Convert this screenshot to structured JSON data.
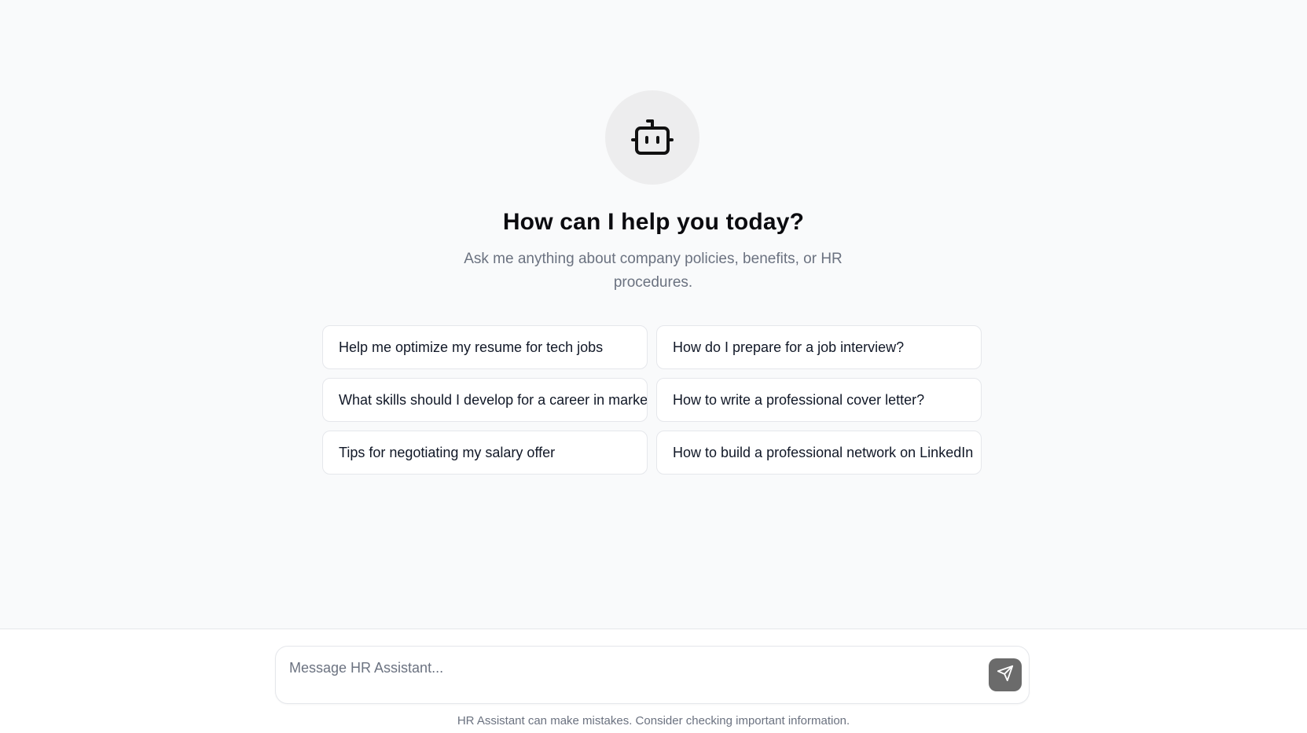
{
  "hero": {
    "icon": "bot-icon",
    "title": "How can I help you today?",
    "subtitle": "Ask me anything about company policies, benefits, or HR procedures."
  },
  "suggestions": [
    {
      "label": "Help me optimize my resume for tech jobs"
    },
    {
      "label": "How do I prepare for a job interview?"
    },
    {
      "label": "What skills should I develop for a career in marketing?"
    },
    {
      "label": "How to write a professional cover letter?"
    },
    {
      "label": "Tips for negotiating my salary offer"
    },
    {
      "label": "How to build a professional network on LinkedIn"
    }
  ],
  "composer": {
    "placeholder": "Message HR Assistant...",
    "value": "",
    "send_icon": "send-icon"
  },
  "disclaimer": "HR Assistant can make mistakes. Consider checking important information.",
  "colors": {
    "background": "#f9fafb",
    "send_button": "#6b6b6b",
    "avatar_bg": "#ededee"
  }
}
